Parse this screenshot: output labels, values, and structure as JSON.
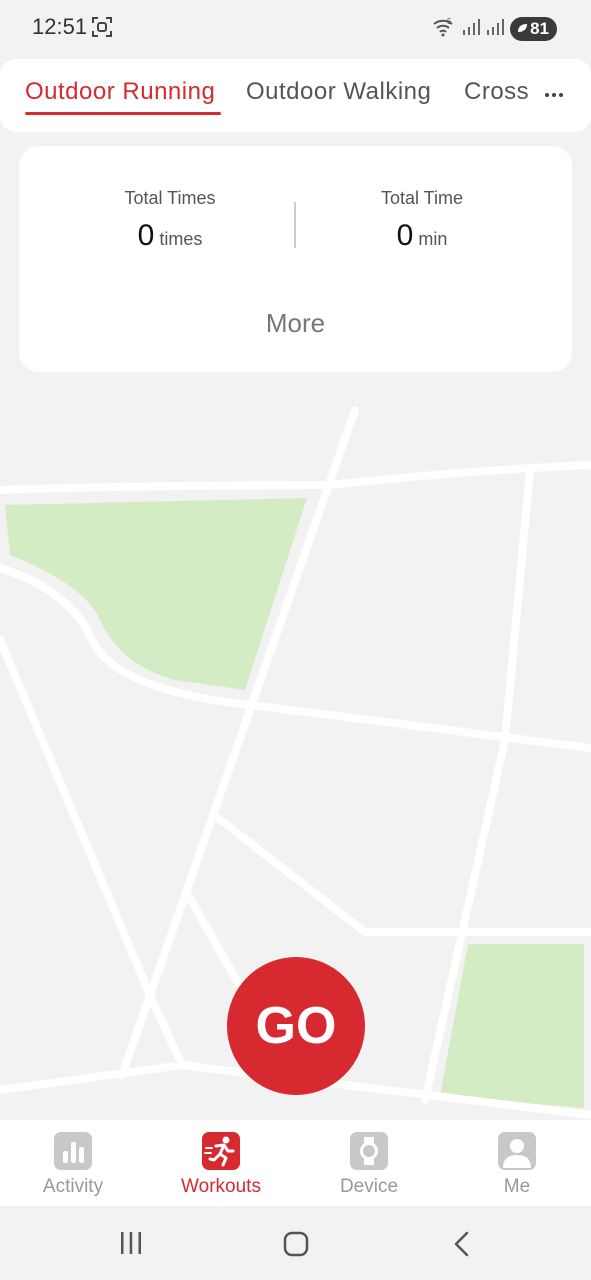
{
  "status_bar": {
    "time": "12:51",
    "battery": "81",
    "icons": [
      "screenshot-icon",
      "wifi-icon",
      "signal-icon",
      "signal-icon",
      "battery-saver-icon"
    ]
  },
  "tabs": {
    "items": [
      {
        "label": "Outdoor Running",
        "active": true
      },
      {
        "label": "Outdoor Walking",
        "active": false
      },
      {
        "label": "Cross",
        "active": false
      }
    ],
    "more_icon": "more-dots-icon"
  },
  "stats": {
    "total_times": {
      "label": "Total Times",
      "value": "0",
      "unit": "times"
    },
    "total_time": {
      "label": "Total Time",
      "value": "0",
      "unit": "min"
    },
    "more_label": "More"
  },
  "go_button": {
    "label": "GO"
  },
  "bottom_nav": {
    "items": [
      {
        "label": "Activity",
        "icon": "bar-chart-icon",
        "active": false
      },
      {
        "label": "Workouts",
        "icon": "runner-icon",
        "active": true
      },
      {
        "label": "Device",
        "icon": "watch-icon",
        "active": false
      },
      {
        "label": "Me",
        "icon": "person-icon",
        "active": false
      }
    ]
  },
  "system_nav": {
    "icons": [
      "recents-icon",
      "home-icon",
      "back-icon"
    ]
  },
  "colors": {
    "accent": "#d62a30",
    "background": "#f2f2f2",
    "park": "#d4ecc4",
    "road": "#ffffff",
    "inactive": "#999999"
  }
}
